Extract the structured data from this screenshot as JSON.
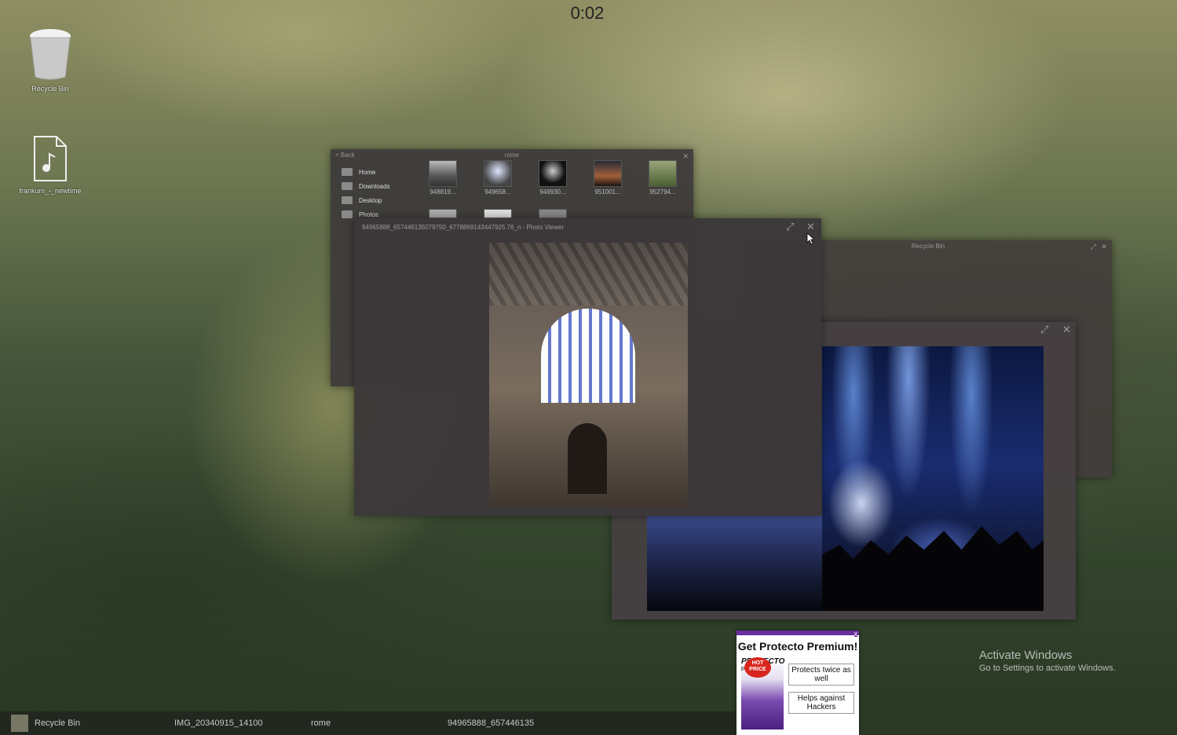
{
  "timer": "0:02",
  "desktop_icons": [
    {
      "label": "Recycle Bin",
      "icon": "recycle-bin-icon"
    },
    {
      "label": "frankum_-_newtime",
      "icon": "music-file-icon"
    }
  ],
  "file_browser": {
    "back_label": "< Back",
    "title": "rome",
    "nav": [
      {
        "label": "Home",
        "icon": "home-icon"
      },
      {
        "label": "Downloads",
        "icon": "downloads-icon"
      },
      {
        "label": "Desktop",
        "icon": "desktop-icon"
      },
      {
        "label": "Photos",
        "icon": "photos-icon"
      }
    ],
    "thumbnails": [
      {
        "name": "948819..."
      },
      {
        "name": "949658..."
      },
      {
        "name": "949930..."
      },
      {
        "name": "951001..."
      },
      {
        "name": "952794..."
      }
    ]
  },
  "photo_viewer_main": {
    "title": "94965888_657446135079750_6778869143447925 76_n - Photo Viewer"
  },
  "recycle_bin_window": {
    "title": "Recycle Bin"
  },
  "ad": {
    "headline": "Get Protecto Premium!",
    "brand": "PROTECTO",
    "brand_sub": "premium",
    "badge": "HOT PRICE",
    "bullet1": "Protects twice as well",
    "bullet2": "Helps against Hackers",
    "close": "x"
  },
  "watermark": {
    "title": "Activate Windows",
    "subtitle": "Go to Settings to activate Windows."
  },
  "taskbar": [
    {
      "label": "Recycle Bin"
    },
    {
      "label": "IMG_20340915_14100"
    },
    {
      "label": "rome"
    },
    {
      "label": "94965888_657446135"
    }
  ],
  "colors": {
    "ad_accent": "#6b2fa0",
    "hot_badge": "#d8261f"
  }
}
